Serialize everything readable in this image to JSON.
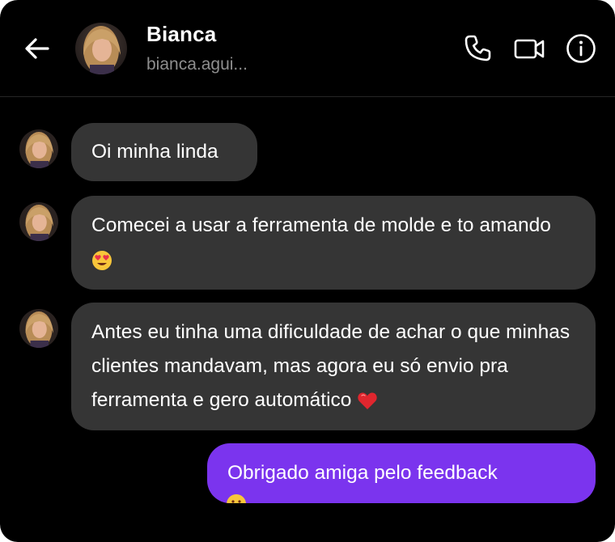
{
  "header": {
    "contact_name": "Bianca",
    "contact_handle": "bianca.agui..."
  },
  "messages": [
    {
      "direction": "incoming",
      "text": "Oi minha linda",
      "emoji": ""
    },
    {
      "direction": "incoming",
      "text": "Comecei a usar a ferramenta de molde e to amando",
      "emoji": "heart-eyes-emoji"
    },
    {
      "direction": "incoming",
      "text": "Antes eu tinha uma dificuldade de achar o que minhas clientes mandavam, mas agora eu só envio pra ferramenta e gero automático",
      "emoji": "red-heart-emoji"
    },
    {
      "direction": "outgoing",
      "text": "Obrigado amiga pelo feedback",
      "emoji": ""
    }
  ],
  "colors": {
    "background": "#000000",
    "incoming_bubble": "#353535",
    "outgoing_bubble": "#7b34ee",
    "secondary_text": "#8e8e8e"
  }
}
